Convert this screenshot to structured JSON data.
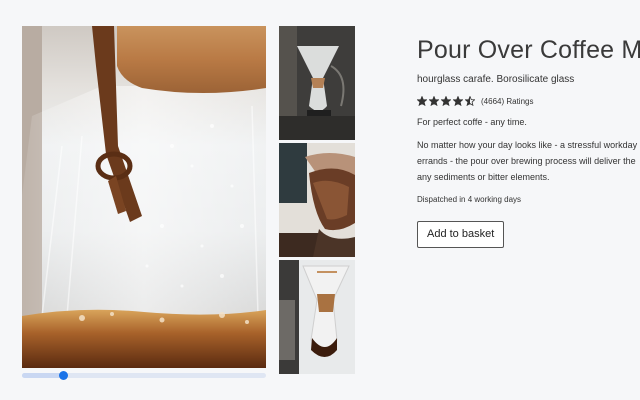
{
  "product": {
    "title": "Pour Over Coffee Maker",
    "subtitle": "hourglass carafe. Borosilicate glass",
    "rating": {
      "stars": 4.5,
      "max_stars": 5,
      "count_text": "(4664) Ratings"
    },
    "tagline": "For perfect coffe - any time.",
    "description_lines": [
      "No matter how your day looks like - a stressful workday",
      "errands - the pour over brewing process will deliver the",
      "any sediments or bitter elements."
    ],
    "dispatch": "Dispatched in 4 working days",
    "add_to_basket_label": "Add to basket"
  },
  "gallery": {
    "main_image": "pour-over-carafe-closeup",
    "thumbnails": [
      "chemex-on-scale",
      "coffee-pouring",
      "chemex-with-coffee"
    ],
    "slider_position": 0.17
  },
  "colors": {
    "accent": "#1a73e8",
    "star": "#333333",
    "background": "#f6f7f9"
  }
}
